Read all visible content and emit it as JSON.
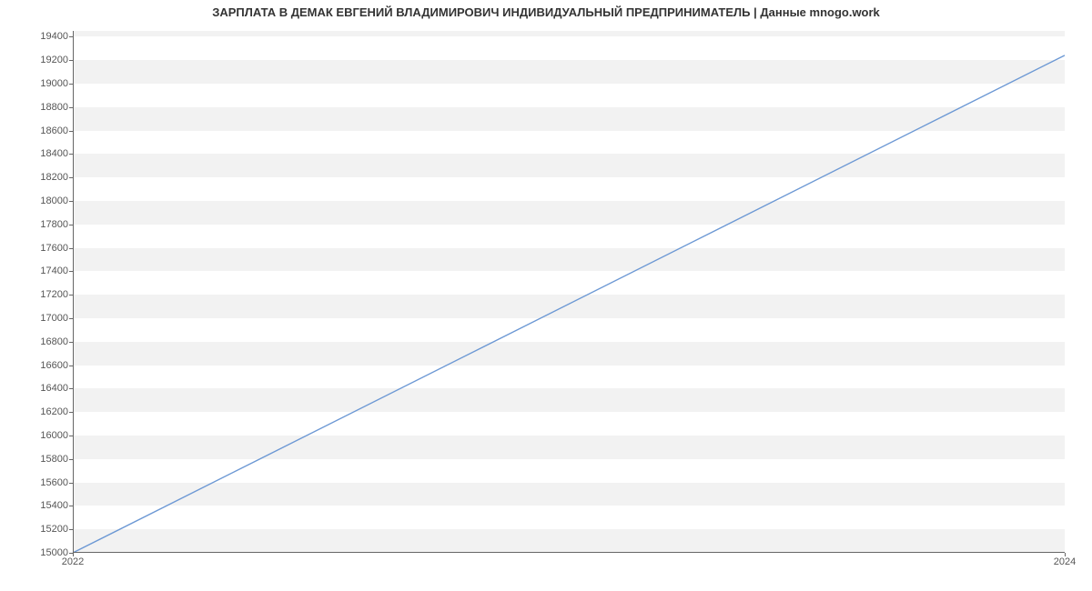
{
  "chart_data": {
    "type": "line",
    "title": "ЗАРПЛАТА В ДЕМАК ЕВГЕНИЙ ВЛАДИМИРОВИЧ ИНДИВИДУАЛЬНЫЙ ПРЕДПРИНИМАТЕЛЬ | Данные mnogo.work",
    "x": [
      2022,
      2024
    ],
    "y": [
      15000,
      19242
    ],
    "xticks": [
      2022,
      2024
    ],
    "yticks": [
      15000,
      15200,
      15400,
      15600,
      15800,
      16000,
      16200,
      16400,
      16600,
      16800,
      17000,
      17200,
      17400,
      17600,
      17800,
      18000,
      18200,
      18400,
      18600,
      18800,
      19000,
      19200,
      19400
    ],
    "xlim": [
      2022,
      2024
    ],
    "ylim": [
      15000,
      19450
    ],
    "line_color": "#6c98d4",
    "grid": {
      "y": true,
      "style": "band",
      "band_color": "#f2f2f2"
    }
  }
}
